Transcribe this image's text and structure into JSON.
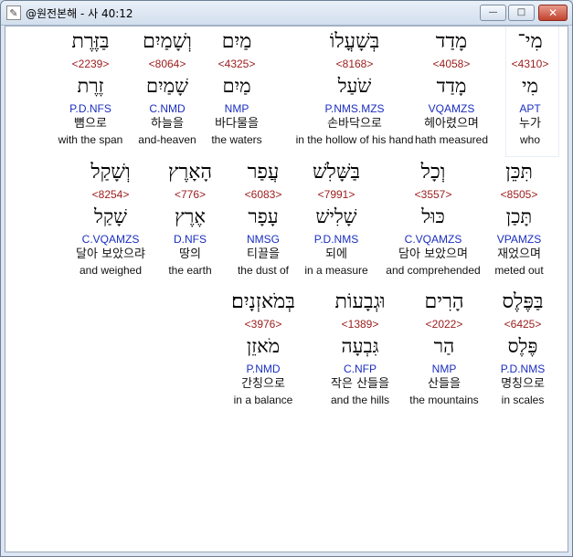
{
  "window": {
    "title": "@원전본해 - 사 40:12",
    "app_icon": "bible-app-icon",
    "controls": {
      "minimize": "—",
      "maximize": "□",
      "close": "✕"
    }
  },
  "rows": [
    [
      {
        "heb": "מִי־",
        "strong": "<4310>",
        "lemma": "מִי",
        "gram": "APT",
        "kor": "누가",
        "eng": "who"
      },
      {
        "heb": "מָדַד",
        "strong": "<4058>",
        "lemma": "מָדַד",
        "gram": "VQAMZS",
        "kor": "헤아렸으며",
        "eng": "hath measured"
      },
      {
        "heb": "בְּשָׁעֳלוֹ",
        "strong": "<8168>",
        "lemma": "שֹׁעַל",
        "gram": "P.NMS.MZS",
        "kor": "손바닥으로",
        "eng": "in the hollow of his hand"
      },
      {
        "heb": "מַיִם",
        "strong": "<4325>",
        "lemma": "מַיִם",
        "gram": "NMP",
        "kor": "바다물을",
        "eng": "the waters"
      },
      {
        "heb": "וְשָׁמַיִם",
        "strong": "<8064>",
        "lemma": "שָׁמַיִם",
        "gram": "C.NMD",
        "kor": "하늘을",
        "eng": "and-heaven"
      },
      {
        "heb": "בַּזֶּרֶת",
        "strong": "<2239>",
        "lemma": "זֶרֶת",
        "gram": "P.D.NFS",
        "kor": "뼘으로",
        "eng": "with the span"
      }
    ],
    [
      {
        "heb": "תִּכֵּן",
        "strong": "<8505>",
        "lemma": "תָּכַן",
        "gram": "VPAMZS",
        "kor": "재었으며",
        "eng": "meted out"
      },
      {
        "heb": "וְכָל",
        "strong": "<3557>",
        "lemma": "כּוּל",
        "gram": "C.VQAMZS",
        "kor": "담아 보았으며",
        "eng": "and comprehended"
      },
      {
        "heb": "בַּשָּׁלִשׁ",
        "strong": "<7991>",
        "lemma": "שָׁלִישׁ",
        "gram": "P.D.NMS",
        "kor": "되에",
        "eng": "in a measure"
      },
      {
        "heb": "עֲפַר",
        "strong": "<6083>",
        "lemma": "עָפָר",
        "gram": "NMSG",
        "kor": "티끌을",
        "eng": "the dust of"
      },
      {
        "heb": "הָאָרֶץ",
        "strong": "<776>",
        "lemma": "אֶרֶץ",
        "gram": "D.NFS",
        "kor": "땅의",
        "eng": "the earth"
      },
      {
        "heb": "וְשָׁקַל",
        "strong": "<8254>",
        "lemma": "שָׁקַל",
        "gram": "C.VQAMZS",
        "kor": "달아 보았으랴",
        "eng": "and weighed"
      }
    ],
    [
      {
        "heb": "בַּפֶּלֶס",
        "strong": "<6425>",
        "lemma": "פֶּלֶס",
        "gram": "P.D.NMS",
        "kor": "명칭으로",
        "eng": "in scales"
      },
      {
        "heb": "הָרִים",
        "strong": "<2022>",
        "lemma": "הַר",
        "gram": "NMP",
        "kor": "산들을",
        "eng": "the mountains"
      },
      {
        "heb": "וּגְבָעוֹת",
        "strong": "<1389>",
        "lemma": "גִּבְעָה",
        "gram": "C.NFP",
        "kor": "작은 산들을",
        "eng": "and the hills"
      },
      {
        "heb": "בְּמֹאזְנָיִם׃",
        "strong": "<3976>",
        "lemma": "מֹאזֵן",
        "gram": "P.NMD",
        "kor": "간칭으로",
        "eng": "in a balance"
      }
    ]
  ],
  "colors": {
    "strong_number": "#9c1b1b",
    "grammar_code": "#1a2ec0",
    "text": "#111111",
    "window_frame": "#dde6f2"
  }
}
